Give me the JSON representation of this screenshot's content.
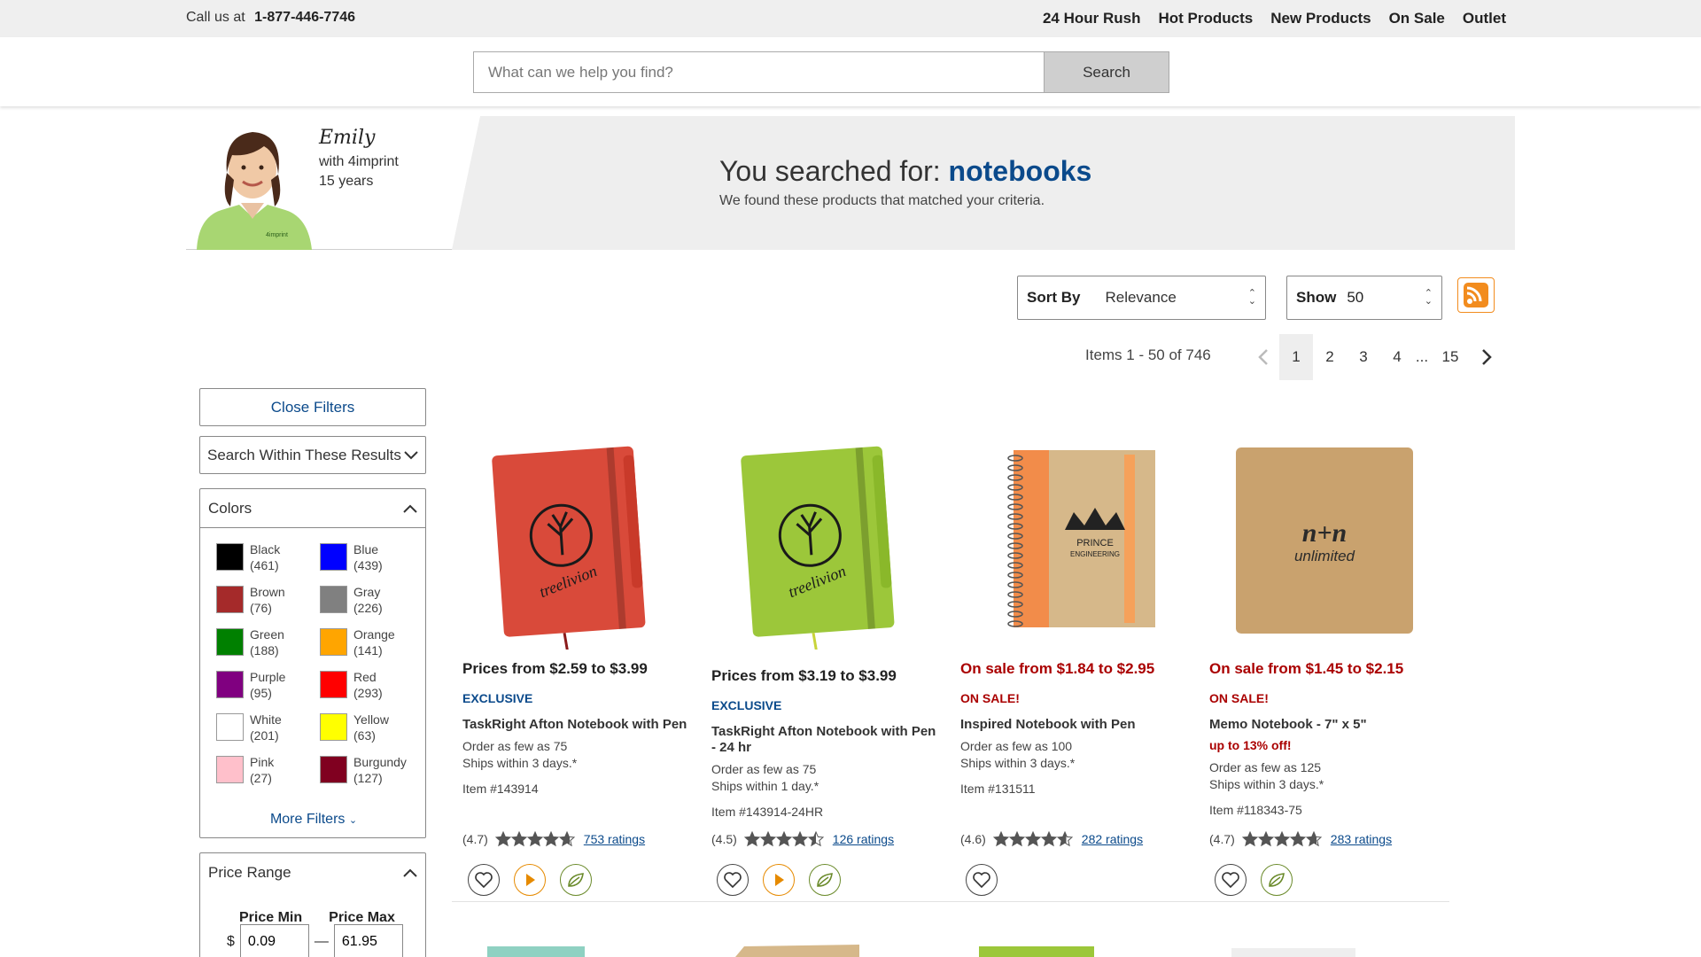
{
  "topbar": {
    "call_label": "Call us at",
    "phone": "1-877-446-7746",
    "links": [
      "24 Hour Rush",
      "Hot Products",
      "New Products",
      "On Sale",
      "Outlet"
    ]
  },
  "search": {
    "placeholder": "What can we help you find?",
    "button_label": "Search"
  },
  "hero": {
    "rep_name": "Emily",
    "rep_line1": "with 4imprint",
    "rep_line2": "15 years",
    "searched_label": "You searched for:",
    "term": "notebooks",
    "subtitle": "We found these products that matched your criteria."
  },
  "sort": {
    "label": "Sort By",
    "value": "Relevance",
    "show_label": "Show",
    "show_value": "50"
  },
  "pagination": {
    "items_text": "Items 1 - 50 of 746",
    "pages": [
      "1",
      "2",
      "3",
      "4",
      "...",
      "15"
    ],
    "current": "1"
  },
  "sidebar": {
    "close_label": "Close Filters",
    "within_label": "Search Within These Results",
    "colors_title": "Colors",
    "colors": [
      {
        "name": "Black",
        "count": "(461)",
        "hex": "#000000"
      },
      {
        "name": "Blue",
        "count": "(439)",
        "hex": "#0000ff"
      },
      {
        "name": "Brown",
        "count": "(76)",
        "hex": "#a52a2a"
      },
      {
        "name": "Gray",
        "count": "(226)",
        "hex": "#808080"
      },
      {
        "name": "Green",
        "count": "(188)",
        "hex": "#008000"
      },
      {
        "name": "Orange",
        "count": "(141)",
        "hex": "#ffa500"
      },
      {
        "name": "Purple",
        "count": "(95)",
        "hex": "#800080"
      },
      {
        "name": "Red",
        "count": "(293)",
        "hex": "#ff0000"
      },
      {
        "name": "White",
        "count": "(201)",
        "hex": "#ffffff"
      },
      {
        "name": "Yellow",
        "count": "(63)",
        "hex": "#ffff00"
      },
      {
        "name": "Pink",
        "count": "(27)",
        "hex": "#ffc0cb"
      },
      {
        "name": "Burgundy",
        "count": "(127)",
        "hex": "#800020"
      }
    ],
    "more_filters": "More Filters",
    "price_title": "Price Range",
    "price_min_label": "Price Min",
    "price_max_label": "Price Max",
    "currency": "$",
    "price_min": "0.09",
    "price_max": "61.95"
  },
  "products": [
    {
      "price": "Prices from $2.59 to $3.99",
      "flag": "EXCLUSIVE",
      "name": "TaskRight Afton Notebook with Pen",
      "discount": "",
      "order": "Order as few as 75",
      "ships": "Ships within 3 days.*",
      "item": "Item #143914",
      "rating": "(4.7)",
      "ratings_count": "753 ratings",
      "stars": 4.7,
      "icons": [
        "heart-icon",
        "video-icon",
        "eco-icon"
      ],
      "color": "#d94a3a",
      "logo_text": "treelivion"
    },
    {
      "price": "Prices from $3.19 to $3.99",
      "flag": "EXCLUSIVE",
      "name": "TaskRight Afton Notebook with Pen - 24 hr",
      "discount": "",
      "order": "Order as few as 75",
      "ships": "Ships within 1 day.*",
      "item": "Item #143914-24HR",
      "rating": "(4.5)",
      "ratings_count": "126 ratings",
      "stars": 4.5,
      "icons": [
        "heart-icon",
        "video-icon",
        "eco-icon"
      ],
      "color": "#9cc73a",
      "logo_text": "treelivion"
    },
    {
      "price": "On sale from $1.84 to $2.95",
      "flag": "ON SALE!",
      "name": "Inspired Notebook with Pen",
      "discount": "",
      "order": "Order as few as 100",
      "ships": "Ships within 3 days.*",
      "item": "Item #131511",
      "rating": "(4.6)",
      "ratings_count": "282 ratings",
      "stars": 4.6,
      "icons": [
        "heart-icon"
      ],
      "color": "#d6b88a",
      "logo_text": "PRINCE ENGINEERING"
    },
    {
      "price": "On sale from $1.45 to $2.15",
      "flag": "ON SALE!",
      "name": "Memo Notebook - 7\" x 5\"",
      "discount": "up to 13% off!",
      "order": "Order as few as 125",
      "ships": "Ships within 3 days.*",
      "item": "Item #118343-75",
      "rating": "(4.7)",
      "ratings_count": "283 ratings",
      "stars": 4.7,
      "icons": [
        "heart-icon",
        "eco-icon"
      ],
      "color": "#c9a26e",
      "logo_text": "n+n unlimited"
    }
  ]
}
